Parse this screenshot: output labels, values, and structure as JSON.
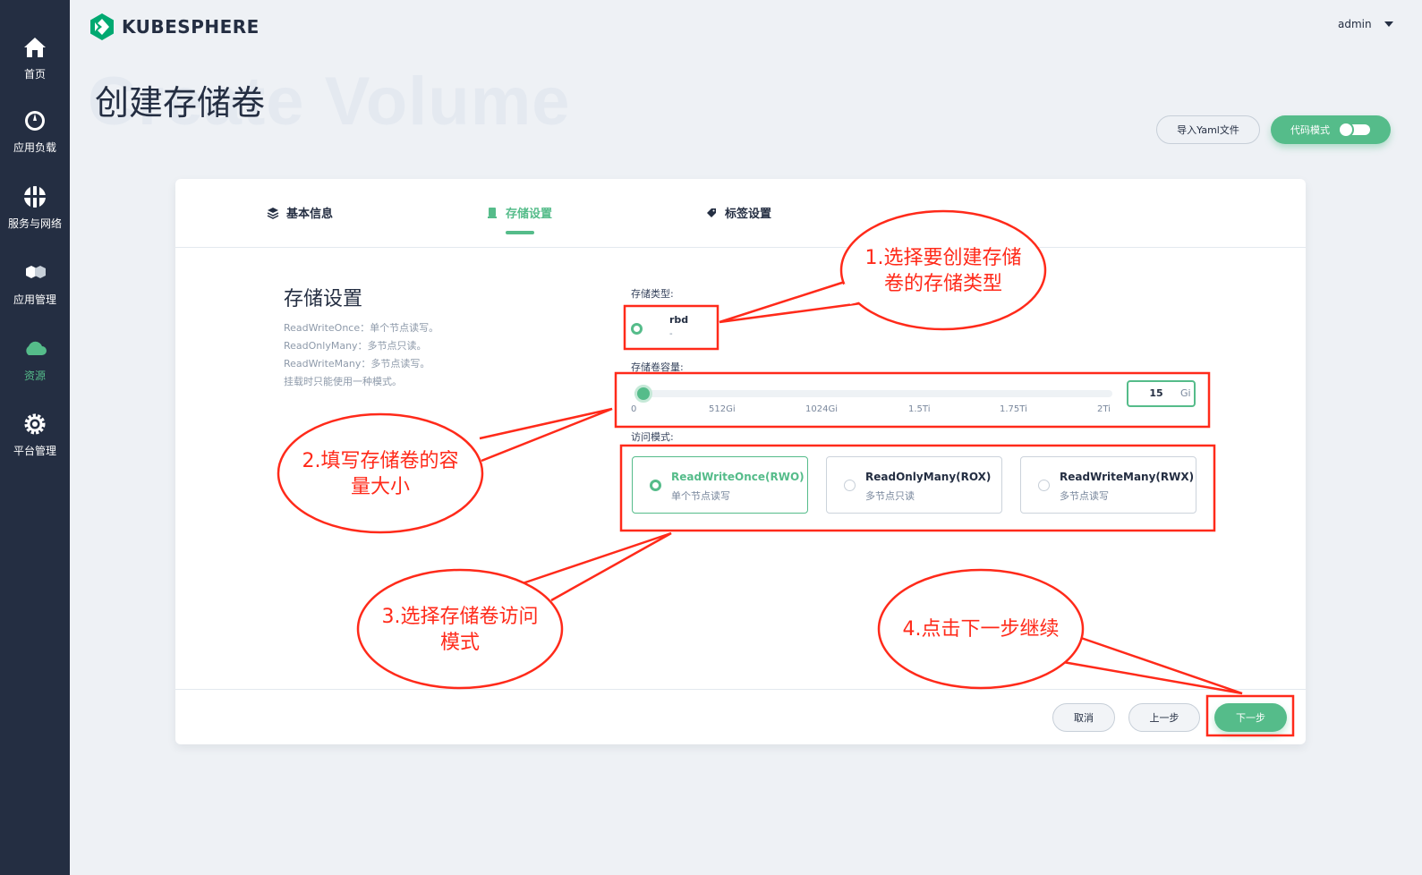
{
  "sidebar": {
    "items": [
      {
        "label": "首页",
        "icon": "home-icon"
      },
      {
        "label": "应用负载",
        "icon": "dashboard-icon"
      },
      {
        "label": "服务与网络",
        "icon": "network-icon"
      },
      {
        "label": "应用管理",
        "icon": "hexagons-icon"
      },
      {
        "label": "资源",
        "icon": "cloud-icon"
      },
      {
        "label": "平台管理",
        "icon": "gear-icon"
      }
    ]
  },
  "header": {
    "logo_text": "KUBESPHERE",
    "user": "admin"
  },
  "page": {
    "title": "创建存储卷",
    "bg_title": "Create Volume",
    "import_yaml": "导入Yaml文件",
    "code_mode": "代码模式"
  },
  "tabs": [
    {
      "label": "基本信息"
    },
    {
      "label": "存储设置"
    },
    {
      "label": "标签设置"
    }
  ],
  "section": {
    "title": "存储设置",
    "desc": [
      "ReadWriteOnce：单个节点读写。",
      "ReadOnlyMany：多节点只读。",
      "ReadWriteMany：多节点读写。",
      "挂载时只能使用一种模式。"
    ]
  },
  "storage_class": {
    "label": "存储类型:",
    "name": "rbd",
    "sub": "-"
  },
  "capacity": {
    "label": "存储卷容量:",
    "value": "15",
    "unit": "Gi",
    "ticks": [
      "0",
      "512Gi",
      "1024Gi",
      "1.5Ti",
      "1.75Ti",
      "2Ti"
    ],
    "fill_fraction": 0.007
  },
  "access": {
    "label": "访问模式:",
    "modes": [
      {
        "name": "ReadWriteOnce(RWO)",
        "sub": "单个节点读写",
        "selected": true
      },
      {
        "name": "ReadOnlyMany(ROX)",
        "sub": "多节点只读",
        "selected": false
      },
      {
        "name": "ReadWriteMany(RWX)",
        "sub": "多节点读写",
        "selected": false
      }
    ]
  },
  "footer": {
    "cancel": "取消",
    "prev": "上一步",
    "next": "下一步"
  },
  "annotations": {
    "a1_line1": "1.选择要创建存储",
    "a1_line2": "卷的存储类型",
    "a2_line1": "2.填写存储卷的容",
    "a2_line2": "量大小",
    "a3_line1": "3.选择存储卷访问",
    "a3_line2": "模式",
    "a4": "4.点击下一步继续"
  },
  "colors": {
    "accent": "#55bc8a",
    "sidebar": "#242e42",
    "annotation": "#ff2a1a"
  }
}
